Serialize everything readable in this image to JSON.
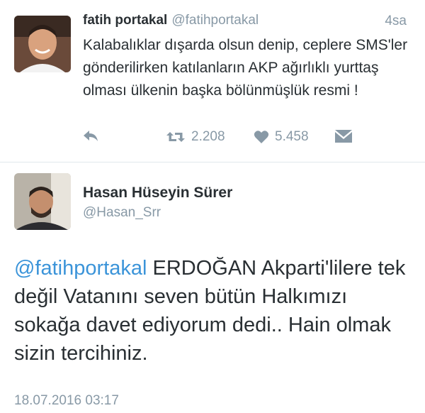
{
  "tweet1": {
    "name": "fatih portakal",
    "handle": "@fatihportakal",
    "time": "4sa",
    "text": "Kalabalıklar dışarda olsun denip, ceplere SMS'ler gönderilirken katılanların AKP ağırlıklı yurttaş olması ülkenin başka bölünmüşlük resmi !",
    "actions": {
      "reply_icon": "reply-icon",
      "retweet_icon": "retweet-icon",
      "retweet_count": "2.208",
      "like_icon": "heart-icon",
      "like_count": "5.458",
      "dm_icon": "direct-message-icon"
    }
  },
  "tweet2": {
    "name": "Hasan Hüseyin Sürer",
    "handle": "@Hasan_Srr",
    "mention": "@fatihportakal",
    "text": " ERDOĞAN Akparti'lilere tek değil Vatanını seven bütün Halkımızı sokağa davet ediyorum dedi.. Hain olmak sizin tercihiniz.",
    "date": "18.07.2016 03:17"
  },
  "colors": {
    "accent": "#3b94d9",
    "muted": "#8899a6",
    "text": "#292f33",
    "divider": "#e1e8ed"
  }
}
